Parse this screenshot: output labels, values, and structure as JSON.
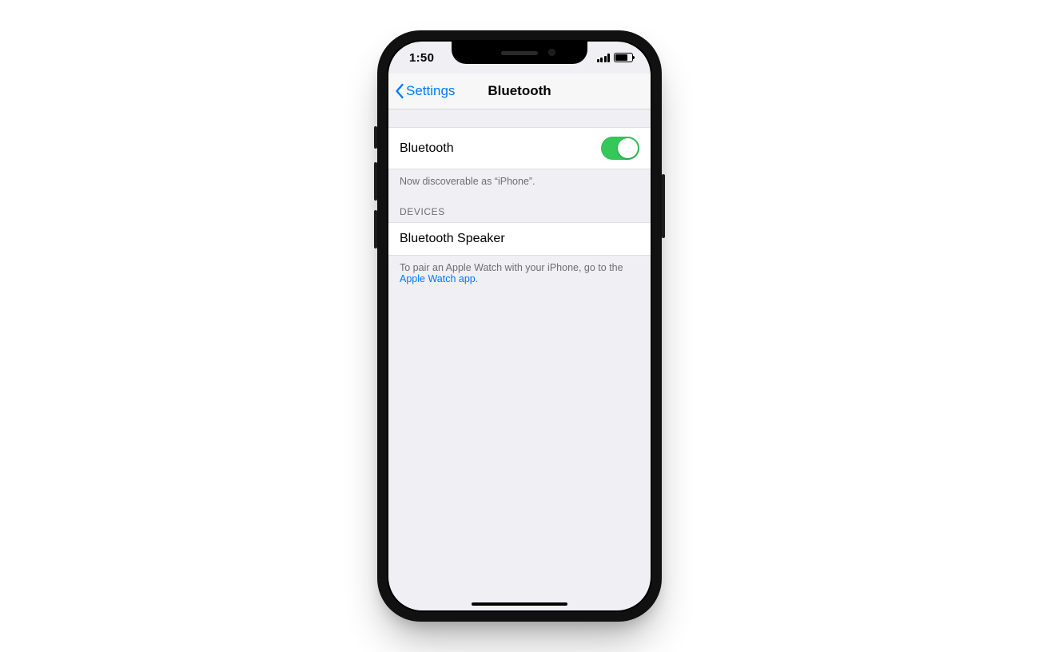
{
  "statusbar": {
    "time": "1:50"
  },
  "navbar": {
    "back_label": "Settings",
    "title": "Bluetooth"
  },
  "bluetooth_cell": {
    "label": "Bluetooth",
    "enabled": true
  },
  "discoverable_text": "Now discoverable as “iPhone”.",
  "devices": {
    "header": "DEVICES",
    "items": [
      {
        "name": "Bluetooth Speaker"
      }
    ]
  },
  "pair_footer": {
    "prefix": "To pair an Apple Watch with your iPhone, go to the ",
    "link": "Apple Watch app",
    "suffix": "."
  }
}
